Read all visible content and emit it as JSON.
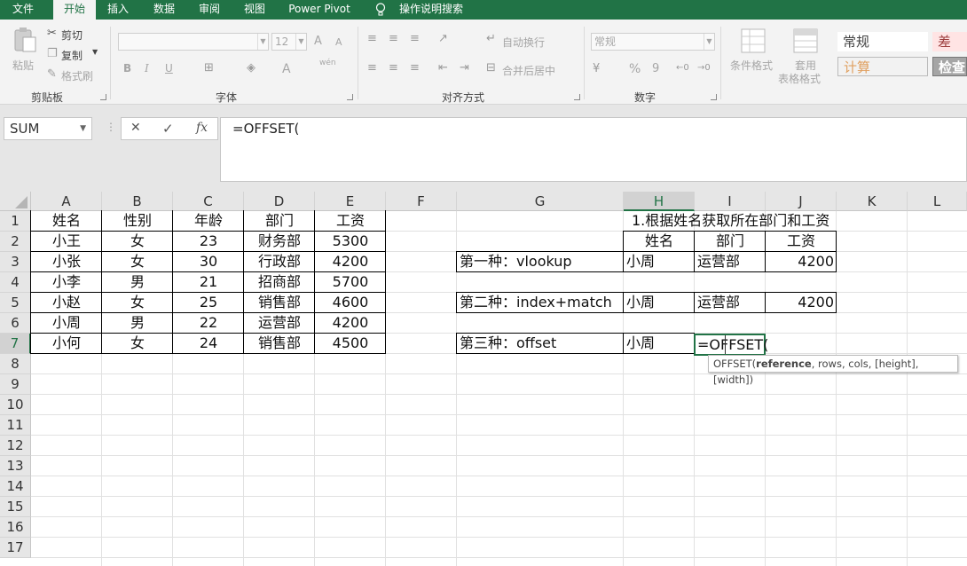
{
  "menu": {
    "tabs": [
      "文件",
      "开始",
      "插入",
      "数据",
      "审阅",
      "视图",
      "Power Pivot"
    ],
    "active": "开始",
    "tell_me": "操作说明搜索"
  },
  "ribbon": {
    "clipboard": {
      "paste": "粘贴",
      "cut": "剪切",
      "copy": "复制",
      "format_painter": "格式刷",
      "label": "剪贴板"
    },
    "font": {
      "size": "12",
      "bold": "B",
      "italic": "I",
      "underline": "U",
      "grow": "A",
      "shrink": "A",
      "color": "A",
      "wen": "wén",
      "label": "字体"
    },
    "alignment": {
      "wrap": "自动换行",
      "merge": "合并后居中",
      "label": "对齐方式"
    },
    "number": {
      "format": "常规",
      "percent": "%",
      "comma": "9",
      "label": "数字"
    },
    "styles": {
      "conditional_line1": "条件格式",
      "table_line1": "套用",
      "table_line2": "表格格式",
      "normal": "常规",
      "bad": "差",
      "calc": "计算",
      "check": "检查"
    }
  },
  "formula_bar": {
    "name_box": "SUM",
    "cancel": "✕",
    "enter": "✓",
    "fx": "fx",
    "formula": "=OFFSET("
  },
  "columns": [
    "A",
    "B",
    "C",
    "D",
    "E",
    "F",
    "G",
    "H",
    "I",
    "J",
    "K",
    "L"
  ],
  "rows": [
    "1",
    "2",
    "3",
    "4",
    "5",
    "6",
    "7",
    "8",
    "9",
    "10",
    "11",
    "12",
    "13",
    "14",
    "15",
    "16",
    "17"
  ],
  "table_left": {
    "headers": [
      "姓名",
      "性别",
      "年龄",
      "部门",
      "工资"
    ],
    "rows": [
      [
        "小王",
        "女",
        "23",
        "财务部",
        "5300"
      ],
      [
        "小张",
        "女",
        "30",
        "行政部",
        "4200"
      ],
      [
        "小李",
        "男",
        "21",
        "招商部",
        "5700"
      ],
      [
        "小赵",
        "女",
        "25",
        "销售部",
        "4600"
      ],
      [
        "小周",
        "男",
        "22",
        "运营部",
        "4200"
      ],
      [
        "小何",
        "女",
        "24",
        "销售部",
        "4500"
      ]
    ]
  },
  "table_right": {
    "title": "1.根据姓名获取所在部门和工资",
    "headers": [
      "姓名",
      "部门",
      "工资"
    ],
    "method1": {
      "label": "第一种：vlookup",
      "name": "小周",
      "dept": "运营部",
      "salary": "4200"
    },
    "method2": {
      "label": "第二种：index+match",
      "name": "小周",
      "dept": "运营部",
      "salary": "4200"
    },
    "method3": {
      "label": "第三种：offset",
      "name": "小周",
      "editing": "=OFFSET("
    }
  },
  "tooltip": {
    "func": "OFFSET(",
    "arg_bold": "reference",
    "rest": ", rows, cols, [height], [width])"
  }
}
